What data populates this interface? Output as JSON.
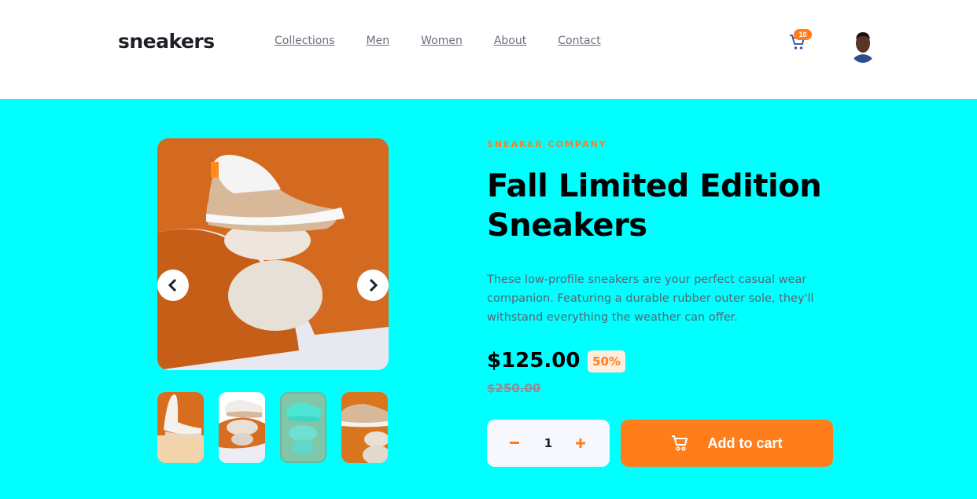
{
  "header": {
    "logo": "sneakers",
    "nav": [
      "Collections",
      "Men",
      "Women",
      "About",
      "Contact"
    ],
    "cart_count": "10"
  },
  "product": {
    "company": "SNEAKER COMPANY",
    "title": "Fall Limited Edition Sneakers",
    "description": "These low-profile sneakers are your perfect casual wear companion. Featuring a durable rubber outer sole, they'll withstand everything the weather can offer.",
    "price": "$125.00",
    "discount": "50%",
    "old_price": "$250.00",
    "quantity": "1",
    "add_to_cart_label": "Add to cart"
  },
  "colors": {
    "accent": "#ff7e1b",
    "background": "#00ffff",
    "dark": "#1d2026"
  }
}
